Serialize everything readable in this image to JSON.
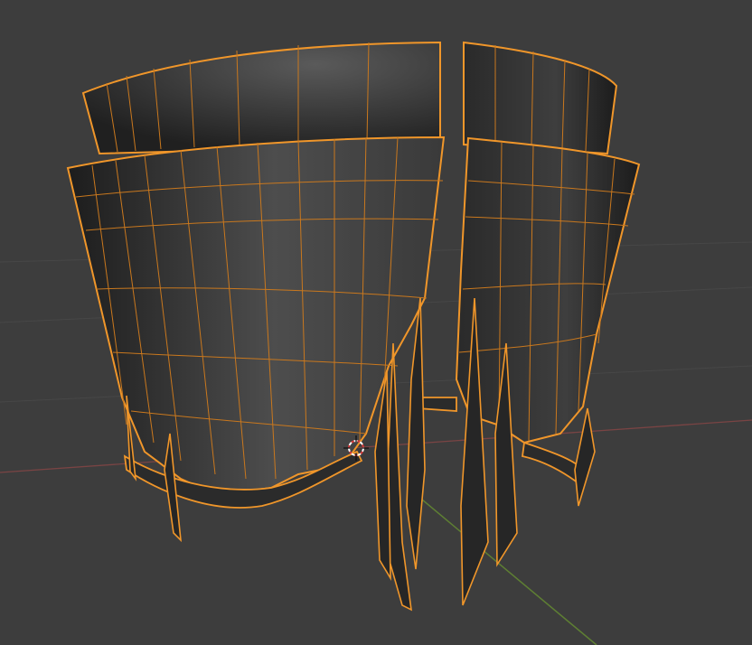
{
  "viewport": {
    "mode": "edit",
    "background": "#3d3d3d",
    "selection_color": "#f0962a",
    "axis_colors": {
      "x": "#8a4a4a",
      "y": "#6a8a3a"
    },
    "objects": [
      {
        "id": "armor-back-left",
        "icon": "mesh-panel"
      },
      {
        "id": "armor-back-right",
        "icon": "mesh-panel"
      },
      {
        "id": "armor-front-left",
        "icon": "mesh-panel"
      },
      {
        "id": "armor-front-right",
        "icon": "mesh-panel"
      }
    ],
    "cursor_icon": "3d-cursor-icon"
  }
}
